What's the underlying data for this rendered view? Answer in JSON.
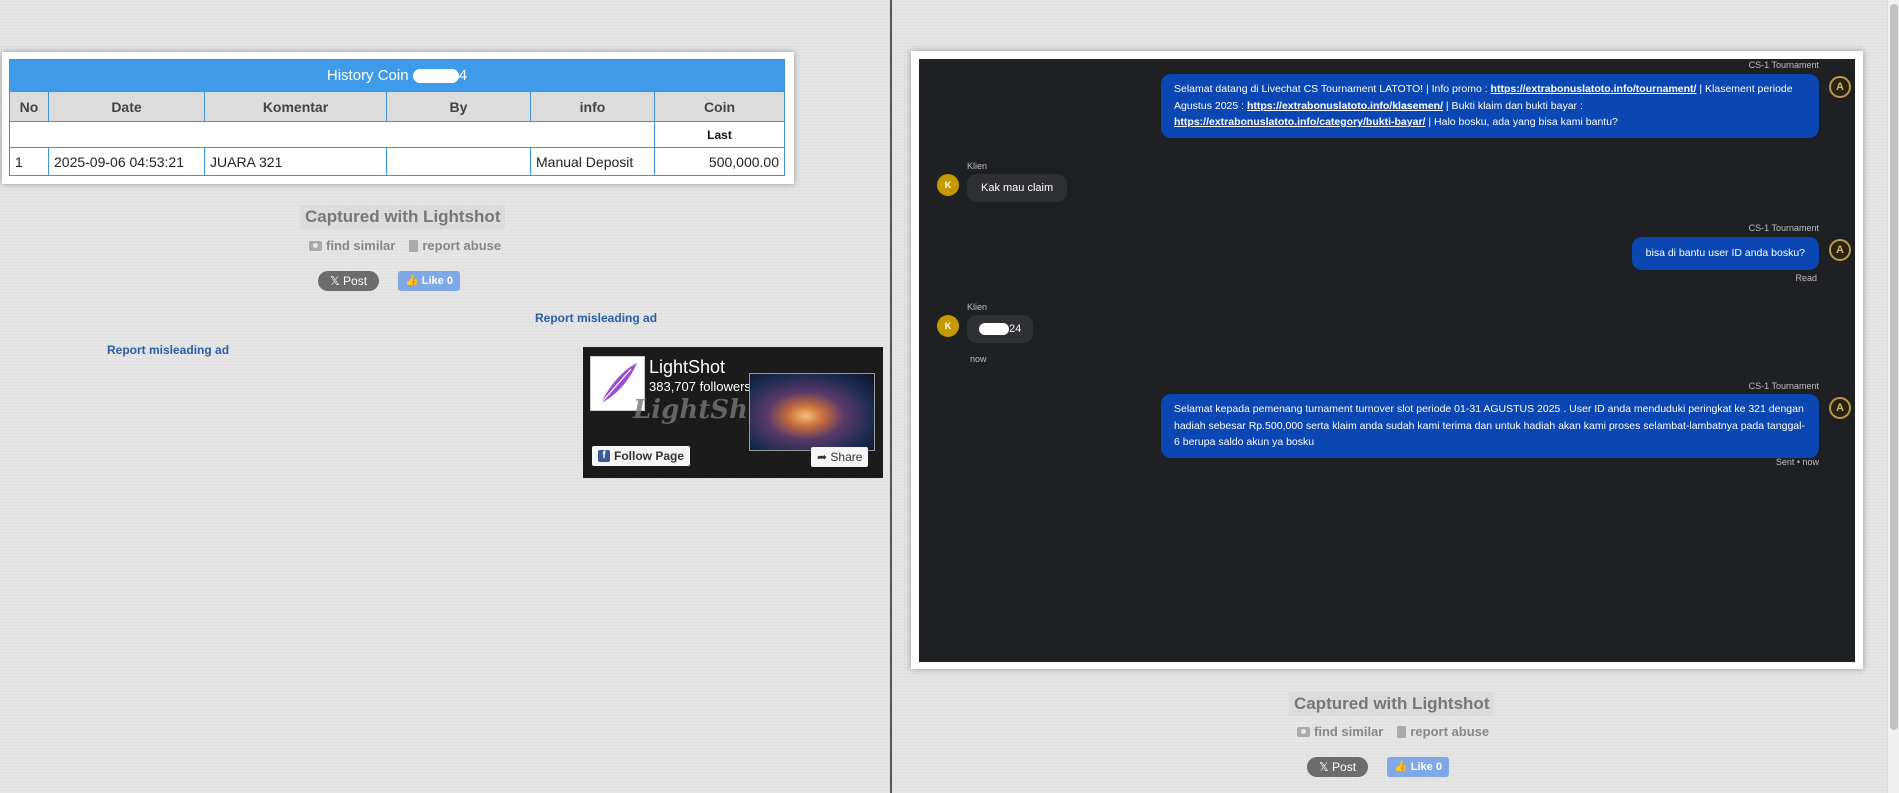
{
  "left": {
    "table": {
      "title": "History Coin",
      "title_suffix": "4",
      "headers": [
        "No",
        "Date",
        "Komentar",
        "By",
        "info",
        "Coin"
      ],
      "sub_header": "Last",
      "rows": [
        {
          "no": "1",
          "date": "2025-09-06 04:53:21",
          "komentar": "JUARA 321",
          "by": "",
          "info": "Manual Deposit",
          "coin": "500,000.00"
        }
      ]
    },
    "captured": "Captured with Lightshot",
    "find_similar": "find similar",
    "report_abuse": "report abuse",
    "post": "Post",
    "like": "Like 0",
    "report_ad_1": "Report misleading ad",
    "report_ad_2": "Report misleading ad",
    "fb": {
      "name": "LightShot",
      "followers": "383,707 followers",
      "watermark": "LightShot",
      "follow": "Follow Page",
      "share": "Share"
    }
  },
  "right": {
    "chat": {
      "agent_label": "CS-1 Tournament",
      "client_label": "Klien",
      "client_initial": "K",
      "agent_initial": "A",
      "msg1": {
        "p1": "Selamat datang di Livechat CS Tournament LATOTO! | Info promo : ",
        "l1": "https://extrabonuslatoto.info/tournament/",
        "p2": " | Klasement periode Agustus 2025 : ",
        "l2": "https://extrabonuslatoto.info/klasemen/",
        "p3": " | Bukti klaim dan bukti bayar : ",
        "l3": "https://extrabonuslatoto.info/category/bukti-bayar/",
        "p4": " | Halo bosku, ada yang bisa kami bantu?"
      },
      "msg2": "Kak mau claim",
      "msg3": "bisa di bantu user ID anda bosku?",
      "msg3_status": "Read",
      "msg4_suffix": "24",
      "msg4_time": "now",
      "msg5": "Selamat kepada pemenang turnament turnover slot periode 01-31 AGUSTUS 2025 . User ID anda menduduki peringkat ke 321 dengan hadiah sebesar Rp.500,000 serta klaim anda sudah kami terima dan untuk hadiah akan kami proses selambat-lambatnya pada tanggal- 6 berupa saldo akun ya bosku",
      "msg5_status": "Sent • now"
    },
    "captured": "Captured with Lightshot",
    "find_similar": "find similar",
    "report_abuse": "report abuse",
    "post": "Post",
    "like": "Like 0"
  }
}
